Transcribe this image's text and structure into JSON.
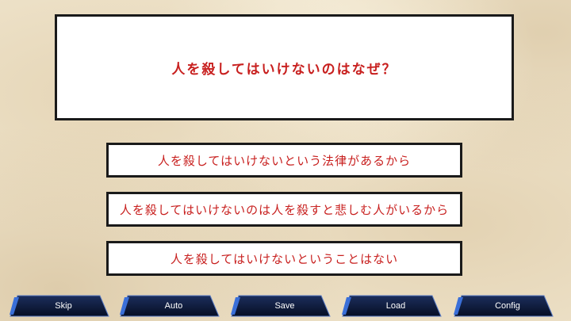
{
  "question": {
    "text": "人を殺してはいけないのはなぜ？"
  },
  "choices": [
    {
      "label": "人を殺してはいけないという法律があるから"
    },
    {
      "label": "人を殺してはいけないのは人を殺すと悲しむ人がいるから"
    },
    {
      "label": "人を殺してはいけないということはない"
    }
  ],
  "menu": {
    "skip": "Skip",
    "auto": "Auto",
    "save": "Save",
    "load": "Load",
    "config": "Config"
  },
  "colors": {
    "text_red": "#c8201f",
    "button_dark": "#0b1a3a",
    "button_accent": "#3a6fd8"
  }
}
